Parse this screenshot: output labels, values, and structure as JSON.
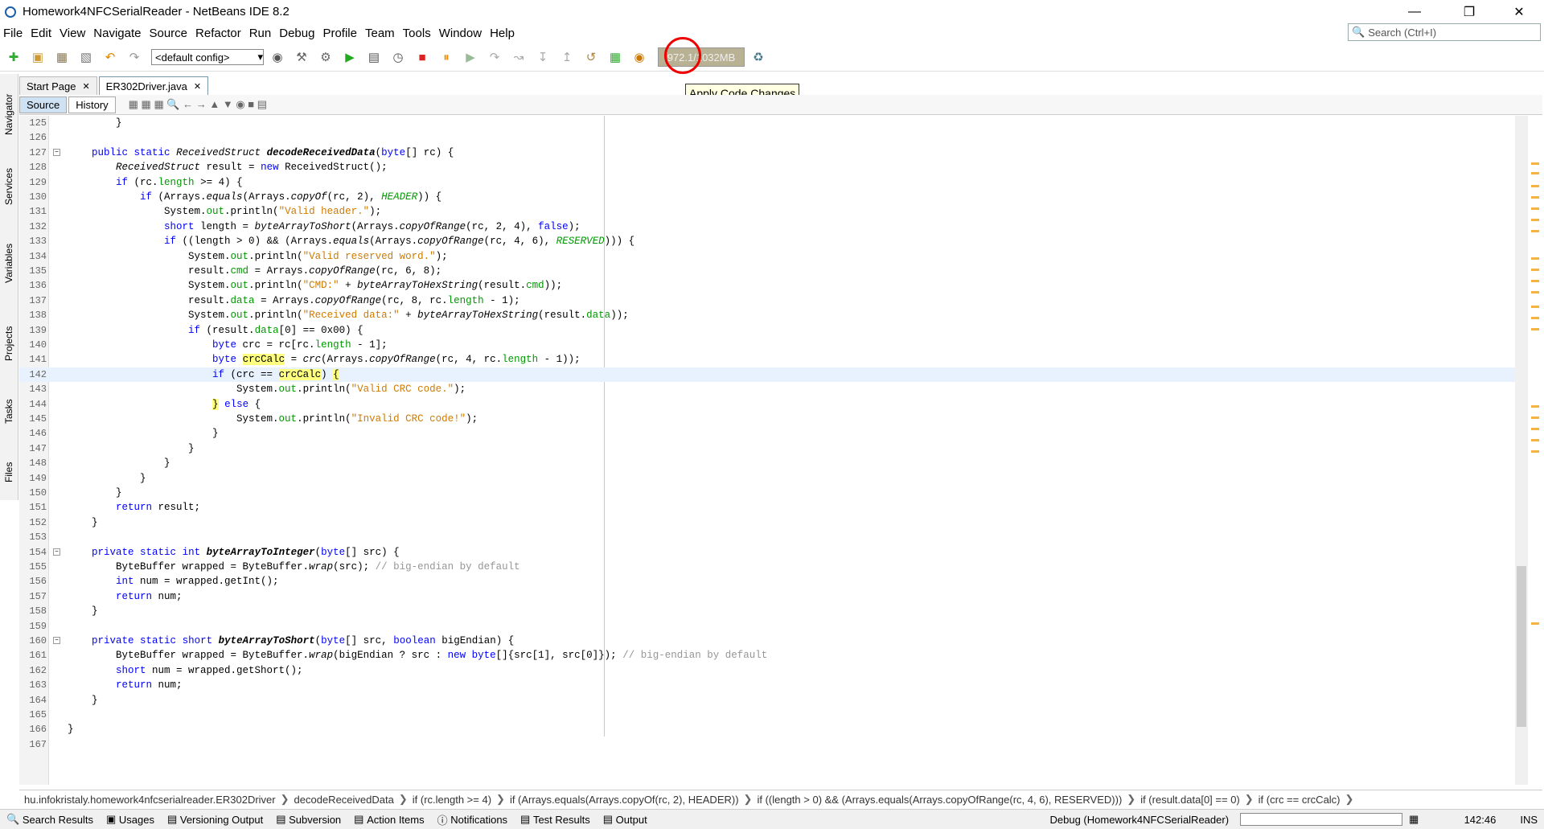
{
  "window": {
    "title": "Homework4NFCSerialReader - NetBeans IDE 8.2",
    "controls": [
      "—",
      "❐",
      "✕"
    ]
  },
  "menu": [
    "File",
    "Edit",
    "View",
    "Navigate",
    "Source",
    "Refactor",
    "Run",
    "Debug",
    "Profile",
    "Team",
    "Tools",
    "Window",
    "Help"
  ],
  "search": {
    "placeholder": "Search (Ctrl+I)"
  },
  "toolbar": {
    "config": "<default config>",
    "memory": "972.1/1032MB",
    "tooltip": "Apply Code Changes",
    "icons": [
      "new-file-icon",
      "new-project-icon",
      "open-project-icon",
      "save-all-icon",
      "undo-icon",
      "redo-icon",
      "config-icon",
      "build-icon",
      "clean-build-icon",
      "run-icon",
      "debug-icon",
      "profile-icon",
      "finish-debugger-icon",
      "pause-icon",
      "continue-icon",
      "step-over-icon",
      "step-over-expr-icon",
      "step-into-icon",
      "step-out-icon",
      "run-to-cursor-icon",
      "apply-code-changes-icon",
      "take-snapshot-icon",
      "gc-icon"
    ]
  },
  "sidepanel": [
    "Navigator",
    "Services",
    "Variables",
    "Projects",
    "Tasks",
    "Files"
  ],
  "tabs": [
    {
      "label": "Start Page",
      "active": false
    },
    {
      "label": "ER302Driver.java",
      "active": true
    }
  ],
  "editor_toggle": {
    "source": "Source",
    "history": "History"
  },
  "code_lines": [
    {
      "n": "125",
      "html": "        }"
    },
    {
      "n": "126",
      "html": ""
    },
    {
      "n": "127",
      "html": "    <span class='kw'>public</span> <span class='kw'>static</span> <span class='it'>ReceivedStruct</span> <span class='bolditalic'>decodeReceivedData</span>(<span class='kw'>byte</span>[] rc) {"
    },
    {
      "n": "128",
      "html": "        <span class='it'>ReceivedStruct</span> result = <span class='kw'>new</span> ReceivedStruct();"
    },
    {
      "n": "129",
      "html": "        <span class='kw'>if</span> (rc.<span class='fld'>length</span> >= 4) {"
    },
    {
      "n": "130",
      "html": "            <span class='kw'>if</span> (Arrays.<span class='it'>equals</span>(Arrays.<span class='it'>copyOf</span>(rc, 2), <span class='fld it'>HEADER</span>)) {"
    },
    {
      "n": "131",
      "html": "                System.<span class='fld'>out</span>.println(<span class='str'>\"Valid header.\"</span>);"
    },
    {
      "n": "132",
      "html": "                <span class='kw'>short</span> length = <span class='it'>byteArrayToShort</span>(Arrays.<span class='it'>copyOfRange</span>(rc, 2, 4), <span class='kw'>false</span>);"
    },
    {
      "n": "133",
      "html": "                <span class='kw'>if</span> ((length > 0) && (Arrays.<span class='it'>equals</span>(Arrays.<span class='it'>copyOfRange</span>(rc, 4, 6), <span class='fld it'>RESERVED</span>))) {"
    },
    {
      "n": "134",
      "html": "                    System.<span class='fld'>out</span>.println(<span class='str'>\"Valid reserved word.\"</span>);"
    },
    {
      "n": "135",
      "html": "                    result.<span class='fld'>cmd</span> = Arrays.<span class='it'>copyOfRange</span>(rc, 6, 8);"
    },
    {
      "n": "136",
      "html": "                    System.<span class='fld'>out</span>.println(<span class='str'>\"CMD:\"</span> + <span class='it'>byteArrayToHexString</span>(result.<span class='fld'>cmd</span>));"
    },
    {
      "n": "137",
      "html": "                    result.<span class='fld'>data</span> = Arrays.<span class='it'>copyOfRange</span>(rc, 8, rc.<span class='fld'>length</span> - 1);"
    },
    {
      "n": "138",
      "html": "                    System.<span class='fld'>out</span>.println(<span class='str'>\"Received data:\"</span> + <span class='it'>byteArrayToHexString</span>(result.<span class='fld'>data</span>));"
    },
    {
      "n": "139",
      "html": "                    <span class='kw'>if</span> (result.<span class='fld'>data</span>[0] == 0x00) {"
    },
    {
      "n": "140",
      "html": "                        <span class='kw'>byte</span> crc = rc[rc.<span class='fld'>length</span> - 1];"
    },
    {
      "n": "141",
      "html": "                        <span class='kw'>byte</span> <span class='hl'>crcCalc</span> = <span class='it'>crc</span>(Arrays.<span class='it'>copyOfRange</span>(rc, 4, rc.<span class='fld'>length</span> - 1));"
    },
    {
      "n": "142",
      "html": "                        <span class='kw'>if</span> (crc == <span class='hl'>crcCalc</span>) <span class='hl'>{</span>"
    },
    {
      "n": "143",
      "html": "                            System.<span class='fld'>out</span>.println(<span class='str'>\"Valid CRC code.\"</span>);"
    },
    {
      "n": "144",
      "html": "                        <span class='hl'>}</span> <span class='kw'>else</span> {"
    },
    {
      "n": "145",
      "html": "                            System.<span class='fld'>out</span>.println(<span class='str'>\"Invalid CRC code!\"</span>);"
    },
    {
      "n": "146",
      "html": "                        }"
    },
    {
      "n": "147",
      "html": "                    }"
    },
    {
      "n": "148",
      "html": "                }"
    },
    {
      "n": "149",
      "html": "            }"
    },
    {
      "n": "150",
      "html": "        }"
    },
    {
      "n": "151",
      "html": "        <span class='kw'>return</span> result;"
    },
    {
      "n": "152",
      "html": "    }"
    },
    {
      "n": "153",
      "html": ""
    },
    {
      "n": "154",
      "html": "    <span class='kw'>private</span> <span class='kw'>static</span> <span class='kw'>int</span> <span class='bolditalic'>byteArrayToInteger</span>(<span class='kw'>byte</span>[] src) {"
    },
    {
      "n": "155",
      "html": "        ByteBuffer wrapped = ByteBuffer.<span class='it'>wrap</span>(src); <span class='cm'>// big-endian by default</span>"
    },
    {
      "n": "156",
      "html": "        <span class='kw'>int</span> num = wrapped.getInt();"
    },
    {
      "n": "157",
      "html": "        <span class='kw'>return</span> num;"
    },
    {
      "n": "158",
      "html": "    }"
    },
    {
      "n": "159",
      "html": ""
    },
    {
      "n": "160",
      "html": "    <span class='kw'>private</span> <span class='kw'>static</span> <span class='kw'>short</span> <span class='bolditalic'>byteArrayToShort</span>(<span class='kw'>byte</span>[] src, <span class='kw'>boolean</span> bigEndian) {"
    },
    {
      "n": "161",
      "html": "        ByteBuffer wrapped = ByteBuffer.<span class='it'>wrap</span>(bigEndian ? src : <span class='kw'>new</span> <span class='kw'>byte</span>[]{src[1], src[0]}); <span class='cm'>// big-endian by default</span>"
    },
    {
      "n": "162",
      "html": "        <span class='kw'>short</span> num = wrapped.getShort();"
    },
    {
      "n": "163",
      "html": "        <span class='kw'>return</span> num;"
    },
    {
      "n": "164",
      "html": "    }"
    },
    {
      "n": "165",
      "html": ""
    },
    {
      "n": "166",
      "html": "}"
    },
    {
      "n": "167",
      "html": ""
    }
  ],
  "current_line": "142",
  "breadcrumb": [
    "hu.infokristaly.homework4nfcserialreader.ER302Driver",
    "decodeReceivedData",
    "if (rc.length >= 4)",
    "if (Arrays.equals(Arrays.copyOf(rc, 2), HEADER))",
    "if ((length > 0) && (Arrays.equals(Arrays.copyOfRange(rc, 4, 6), RESERVED)))",
    "if (result.data[0] == 0)",
    "if (crc == crcCalc)"
  ],
  "status": {
    "items": [
      "Search Results",
      "Usages",
      "Versioning Output",
      "Subversion",
      "Action Items",
      "Notifications",
      "Test Results",
      "Output"
    ],
    "session": "Debug (Homework4NFCSerialReader)",
    "position": "142:46",
    "mode": "INS"
  }
}
